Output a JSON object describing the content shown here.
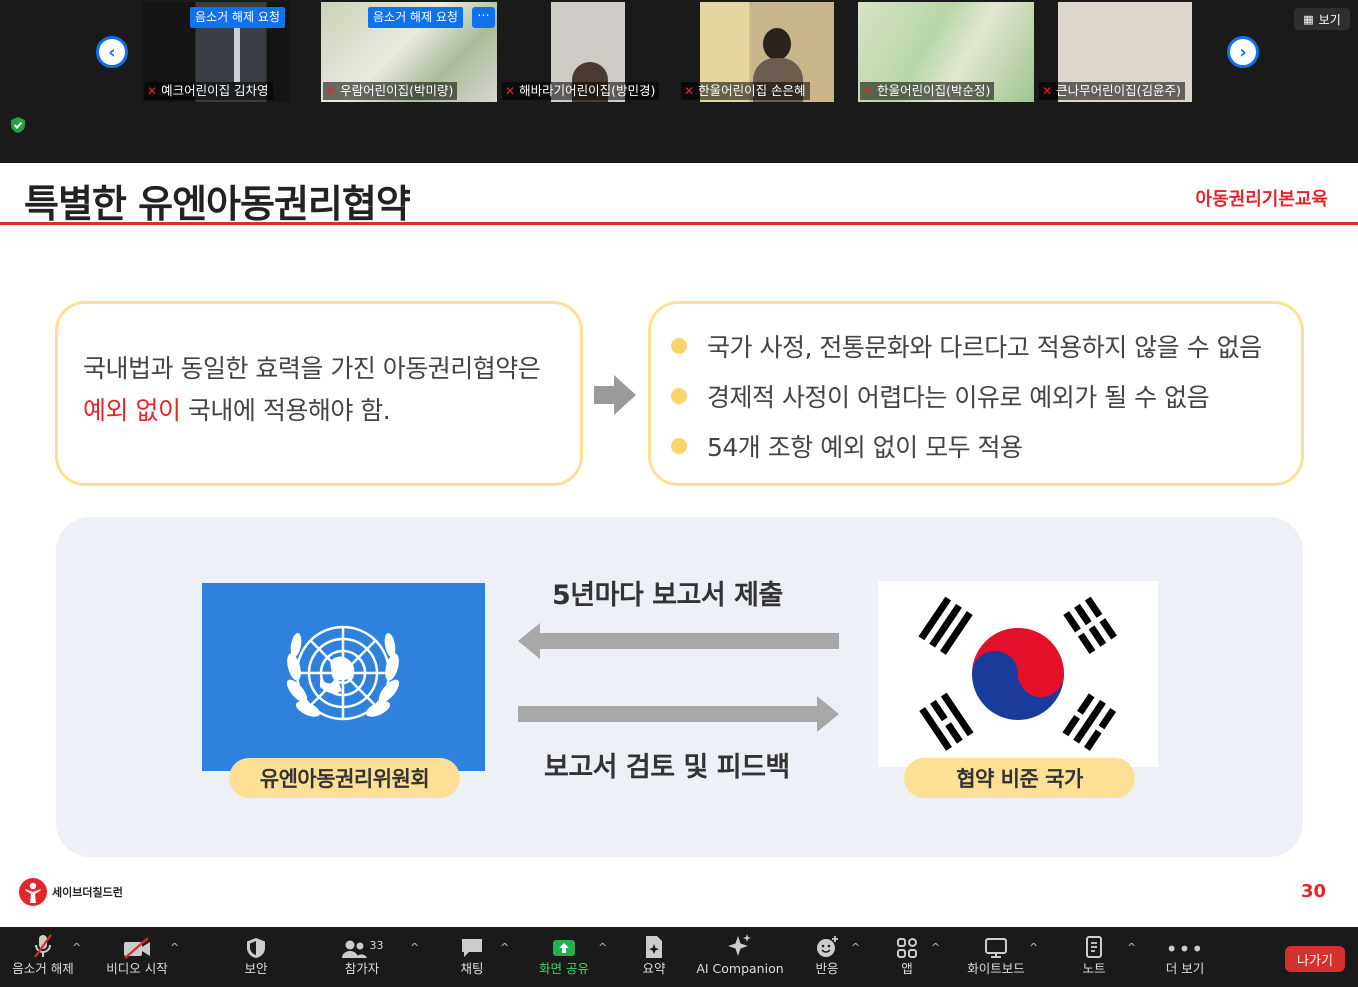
{
  "gallery": {
    "nav_prev_icon": "chevron-left-icon",
    "nav_next_icon": "chevron-right-icon",
    "view_label": "보기",
    "participants": [
      {
        "name": "예크어린이집 김차영",
        "unmute_request": "음소거 해제 요청",
        "more": "···"
      },
      {
        "name": "우람어린이집(박미량)",
        "unmute_request": "음소거 해제 요청",
        "more": "···"
      },
      {
        "name": "해바라기어린이집(방민경)"
      },
      {
        "name": "한울어린이집 손은혜"
      },
      {
        "name": "한울어린이집(박순정)"
      },
      {
        "name": "큰나무어린이집(김윤주)"
      }
    ]
  },
  "slide": {
    "title": "특별한 유엔아동권리협약",
    "subtitle": "아동권리기본교육",
    "left_box": {
      "line1": "국내법과 동일한 효력을 가진 아동권리협약은",
      "line2_red": "예외 없이",
      "line2_rest": " 국내에 적용해야 함."
    },
    "bullets": [
      "국가 사정, 전통문화와 다르다고 적용하지 않을 수 없음",
      "경제적 사정이 어렵다는 이유로 예외가 될 수 없음",
      "54개 조항 예외 없이 모두 적용"
    ],
    "flow_top": "5년마다 보고서 제출",
    "flow_bottom": "보고서 검토 및 피드백",
    "un_label": "유엔아동권리위원회",
    "kr_label": "협약 비준 국가",
    "logo_text": "세이브더칠드런",
    "page_number": "30"
  },
  "toolbar": {
    "items": [
      {
        "label": "음소거 해제",
        "icon": "microphone-muted-icon"
      },
      {
        "label": "비디오 시작",
        "icon": "video-off-icon"
      },
      {
        "label": "보안",
        "icon": "shield-icon"
      },
      {
        "label": "참가자",
        "icon": "participants-icon",
        "count": "33"
      },
      {
        "label": "채팅",
        "icon": "chat-icon"
      },
      {
        "label": "화면 공유",
        "icon": "share-screen-icon"
      },
      {
        "label": "요약",
        "icon": "summary-icon"
      },
      {
        "label": "AI Companion",
        "icon": "ai-companion-icon"
      },
      {
        "label": "반응",
        "icon": "reaction-icon"
      },
      {
        "label": "앱",
        "icon": "apps-icon"
      },
      {
        "label": "화이트보드",
        "icon": "whiteboard-icon"
      },
      {
        "label": "노트",
        "icon": "notes-icon"
      },
      {
        "label": "더 보기",
        "icon": "more-icon"
      }
    ],
    "leave_label": "나가기"
  },
  "colors": {
    "accent_blue": "#0e72ed",
    "slide_red": "#e3262b",
    "pill_yellow": "#fde096",
    "box_border": "#fbe196",
    "panel_bg": "#eef0f8",
    "un_blue": "#2f81de",
    "share_green": "#3bd36d",
    "leave_red": "#d5302d"
  }
}
